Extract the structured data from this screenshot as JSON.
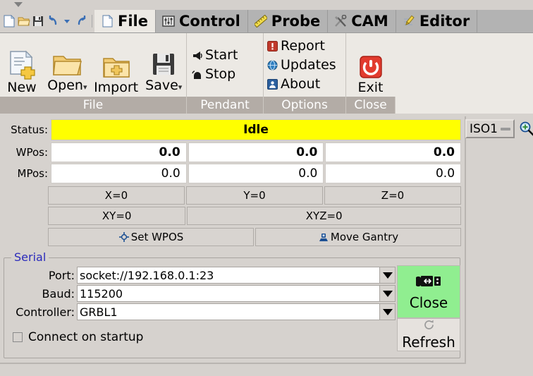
{
  "window": {
    "collapse_caret": "collapse-arrow"
  },
  "quick_access": {
    "items": [
      {
        "name": "new-file-icon",
        "label": "New"
      },
      {
        "name": "open-folder-icon",
        "label": "Open"
      },
      {
        "name": "save-disk-icon",
        "label": "Save"
      },
      {
        "name": "undo-icon",
        "label": "Undo"
      },
      {
        "name": "undo-dropdown-icon",
        "label": "Undo history"
      },
      {
        "name": "redo-icon",
        "label": "Redo"
      }
    ]
  },
  "tabs": [
    {
      "label": "File",
      "icon": "page-icon",
      "active": true
    },
    {
      "label": "Control",
      "icon": "sliders-icon",
      "active": false
    },
    {
      "label": "Probe",
      "icon": "ruler-icon",
      "active": false
    },
    {
      "label": "CAM",
      "icon": "tools-icon",
      "active": false
    },
    {
      "label": "Editor",
      "icon": "pencil-icon",
      "active": false
    }
  ],
  "ribbon": {
    "groups": [
      {
        "caption": "File",
        "buttons": [
          {
            "label": "New",
            "icon": "new-document-icon",
            "dropdown": false
          },
          {
            "label": "Open",
            "icon": "open-folder-icon",
            "dropdown": true,
            "dropdown_glyph": "▾"
          },
          {
            "label": "Import",
            "icon": "import-folder-icon",
            "dropdown": false
          },
          {
            "label": "Save",
            "icon": "floppy-disk-icon",
            "dropdown": true,
            "dropdown_glyph": "▾"
          }
        ]
      },
      {
        "caption": "Pendant",
        "items": [
          {
            "label": "Start",
            "icon": "pendant-start-icon"
          },
          {
            "label": "Stop",
            "icon": "pendant-stop-icon"
          }
        ]
      },
      {
        "caption": "Options",
        "items": [
          {
            "label": "Report",
            "icon": "report-alert-icon"
          },
          {
            "label": "Updates",
            "icon": "globe-updates-icon"
          },
          {
            "label": "About",
            "icon": "about-person-icon"
          }
        ]
      },
      {
        "caption": "Close",
        "buttons": [
          {
            "label": "Exit",
            "icon": "power-exit-icon",
            "dropdown": false
          }
        ]
      }
    ]
  },
  "status_panel": {
    "status_label": "Status:",
    "status_value": "Idle",
    "status_color": "#ffff00",
    "wpos_label": "WPos:",
    "wpos_values": [
      "0.0",
      "0.0",
      "0.0"
    ],
    "mpos_label": "MPos:",
    "mpos_values": [
      "0.0",
      "0.0",
      "0.0"
    ],
    "zero_buttons": [
      "X=0",
      "Y=0",
      "Z=0"
    ],
    "zero_buttons2": [
      "XY=0",
      "XYZ=0"
    ],
    "action_buttons": [
      {
        "label": "Set WPOS",
        "icon": "crosshair-icon"
      },
      {
        "label": "Move Gantry",
        "icon": "gantry-icon"
      }
    ],
    "unit_selector": "ISO1",
    "zoom_icon": "zoom-in-icon"
  },
  "serial": {
    "title": "Serial",
    "fields": [
      {
        "label": "Port:",
        "value": "socket://192.168.0.1:23"
      },
      {
        "label": "Baud:",
        "value": "115200"
      },
      {
        "label": "Controller:",
        "value": "GRBL1"
      }
    ],
    "checkbox": {
      "label": "Connect on startup",
      "checked": false
    },
    "connect_button": {
      "label": "Close",
      "icon": "usb-plug-icon",
      "color": "#90ee90"
    },
    "refresh_button": {
      "label": "Refresh",
      "icon": "refresh-icon"
    }
  }
}
